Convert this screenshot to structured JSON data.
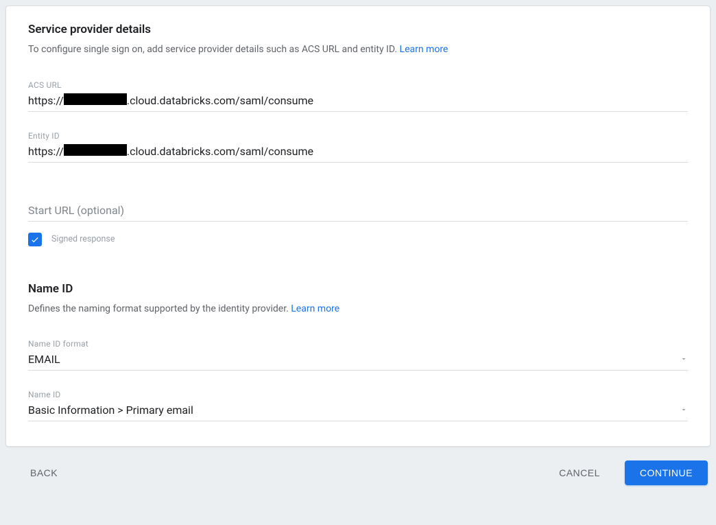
{
  "sp": {
    "title": "Service provider details",
    "desc": "To configure single sign on, add service provider details such as ACS URL and entity ID. ",
    "learn_more": "Learn more",
    "acs_label": "ACS URL",
    "acs_prefix": "https://",
    "acs_suffix": ".cloud.databricks.com/saml/consume",
    "entity_label": "Entity ID",
    "entity_prefix": "https://",
    "entity_suffix": ".cloud.databricks.com/saml/consume",
    "start_url_placeholder": "Start URL (optional)",
    "signed_response_label": "Signed response",
    "signed_response_checked": true
  },
  "nameid": {
    "title": "Name ID",
    "desc": "Defines the naming format supported by the identity provider. ",
    "learn_more": "Learn more",
    "format_label": "Name ID format",
    "format_value": "EMAIL",
    "mapping_label": "Name ID",
    "mapping_value": "Basic Information > Primary email"
  },
  "footer": {
    "back": "BACK",
    "cancel": "CANCEL",
    "continue": "CONTINUE"
  }
}
